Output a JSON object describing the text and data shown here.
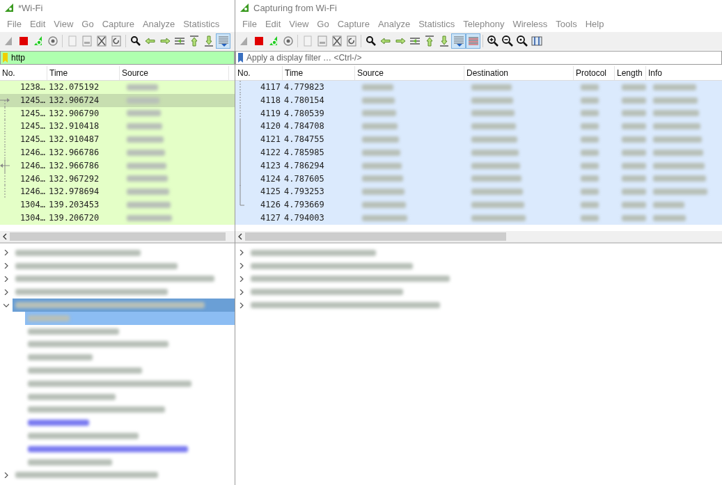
{
  "windows": [
    {
      "title": "*Wi-Fi",
      "menu": [
        "File",
        "Edit",
        "View",
        "Go",
        "Capture",
        "Analyze",
        "Statistics"
      ],
      "toolbar": [
        {
          "kind": "fin",
          "selected": false
        },
        {
          "kind": "stop",
          "selected": false
        },
        {
          "kind": "restart",
          "selected": false
        },
        {
          "kind": "options",
          "selected": false
        },
        {
          "kind": "sep"
        },
        {
          "kind": "open",
          "selected": false
        },
        {
          "kind": "save",
          "selected": false
        },
        {
          "kind": "close",
          "selected": false
        },
        {
          "kind": "reload",
          "selected": false
        },
        {
          "kind": "sep"
        },
        {
          "kind": "find",
          "selected": false
        },
        {
          "kind": "back",
          "selected": false
        },
        {
          "kind": "forward",
          "selected": false
        },
        {
          "kind": "goto",
          "selected": false
        },
        {
          "kind": "first",
          "selected": false
        },
        {
          "kind": "last",
          "selected": false
        },
        {
          "kind": "autoscroll",
          "selected": true
        }
      ],
      "filter": {
        "value": "http",
        "valid": true
      },
      "columns": [
        "No.",
        "Time",
        "Source"
      ],
      "rows": [
        {
          "no": "1238…",
          "time": "132.075192",
          "kind": "none",
          "selected": false
        },
        {
          "no": "1245…",
          "time": "132.906724",
          "kind": "request",
          "selected": true
        },
        {
          "no": "1245…",
          "time": "132.906790",
          "kind": "dashed",
          "selected": false
        },
        {
          "no": "1245…",
          "time": "132.910418",
          "kind": "dashed",
          "selected": false
        },
        {
          "no": "1245…",
          "time": "132.910487",
          "kind": "dashed",
          "selected": false
        },
        {
          "no": "1246…",
          "time": "132.966786",
          "kind": "dashed",
          "selected": false
        },
        {
          "no": "1246…",
          "time": "132.966786",
          "kind": "response",
          "selected": false
        },
        {
          "no": "1246…",
          "time": "132.967292",
          "kind": "dashed",
          "selected": false
        },
        {
          "no": "1246…",
          "time": "132.978694",
          "kind": "dashed",
          "selected": false
        },
        {
          "no": "1304…",
          "time": "139.203453",
          "kind": "none",
          "selected": false
        },
        {
          "no": "1304…",
          "time": "139.206720",
          "kind": "none",
          "selected": false
        }
      ],
      "details": [
        {
          "expanded": false,
          "selected": false
        },
        {
          "expanded": false,
          "selected": false
        },
        {
          "expanded": false,
          "selected": false
        },
        {
          "expanded": false,
          "selected": false
        },
        {
          "expanded": true,
          "selected": true,
          "children": [
            {
              "kind": "field",
              "selected": true
            },
            {
              "kind": "field",
              "selected": false
            },
            {
              "kind": "field",
              "selected": false
            },
            {
              "kind": "field",
              "selected": false
            },
            {
              "kind": "field",
              "selected": false
            },
            {
              "kind": "field",
              "selected": false
            },
            {
              "kind": "field",
              "selected": false
            },
            {
              "kind": "field",
              "selected": false
            },
            {
              "kind": "link",
              "selected": false
            },
            {
              "kind": "field",
              "selected": false
            },
            {
              "kind": "link",
              "selected": false
            },
            {
              "kind": "field",
              "selected": false
            }
          ]
        },
        {
          "expanded": false,
          "selected": false
        }
      ]
    },
    {
      "title": "Capturing from Wi-Fi",
      "menu": [
        "File",
        "Edit",
        "View",
        "Go",
        "Capture",
        "Analyze",
        "Statistics",
        "Telephony",
        "Wireless",
        "Tools",
        "Help"
      ],
      "toolbar": [
        {
          "kind": "fin",
          "selected": false
        },
        {
          "kind": "stop",
          "selected": false
        },
        {
          "kind": "restart",
          "selected": false
        },
        {
          "kind": "options",
          "selected": false
        },
        {
          "kind": "sep"
        },
        {
          "kind": "open",
          "selected": false
        },
        {
          "kind": "save",
          "selected": false
        },
        {
          "kind": "close",
          "selected": false
        },
        {
          "kind": "reload",
          "selected": false
        },
        {
          "kind": "sep"
        },
        {
          "kind": "find",
          "selected": false
        },
        {
          "kind": "back",
          "selected": false
        },
        {
          "kind": "forward",
          "selected": false
        },
        {
          "kind": "goto",
          "selected": false
        },
        {
          "kind": "first",
          "selected": false
        },
        {
          "kind": "last",
          "selected": false
        },
        {
          "kind": "autoscroll",
          "selected": true
        },
        {
          "kind": "colorize",
          "selected": true
        },
        {
          "kind": "sep"
        },
        {
          "kind": "zoom-in",
          "selected": false
        },
        {
          "kind": "zoom-out",
          "selected": false
        },
        {
          "kind": "zoom-reset",
          "selected": false
        },
        {
          "kind": "resize",
          "selected": false
        }
      ],
      "filter": {
        "placeholder": "Apply a display filter … <Ctrl-/>",
        "valid": false
      },
      "columns": [
        "No.",
        "Time",
        "Source",
        "Destination",
        "Protocol",
        "Length",
        "Info"
      ],
      "rows": [
        {
          "no": "4117",
          "time": "4.779823",
          "kind": "dashed",
          "selected": false
        },
        {
          "no": "4118",
          "time": "4.780154",
          "kind": "dashed",
          "selected": false
        },
        {
          "no": "4119",
          "time": "4.780539",
          "kind": "dashed",
          "selected": false
        },
        {
          "no": "4120",
          "time": "4.784708",
          "kind": "solid",
          "selected": false
        },
        {
          "no": "4121",
          "time": "4.784755",
          "kind": "solid",
          "selected": false
        },
        {
          "no": "4122",
          "time": "4.785985",
          "kind": "solid",
          "selected": false
        },
        {
          "no": "4123",
          "time": "4.786294",
          "kind": "solid",
          "selected": false
        },
        {
          "no": "4124",
          "time": "4.787605",
          "kind": "solid",
          "selected": false
        },
        {
          "no": "4125",
          "time": "4.793253",
          "kind": "solid",
          "selected": false
        },
        {
          "no": "4126",
          "time": "4.793669",
          "kind": "end",
          "selected": false
        },
        {
          "no": "4127",
          "time": "4.794003",
          "kind": "none",
          "selected": false
        }
      ],
      "details": [
        {
          "expanded": false,
          "selected": false
        },
        {
          "expanded": false,
          "selected": false
        },
        {
          "expanded": false,
          "selected": false
        },
        {
          "expanded": false,
          "selected": false
        },
        {
          "expanded": false,
          "selected": false
        }
      ]
    }
  ]
}
